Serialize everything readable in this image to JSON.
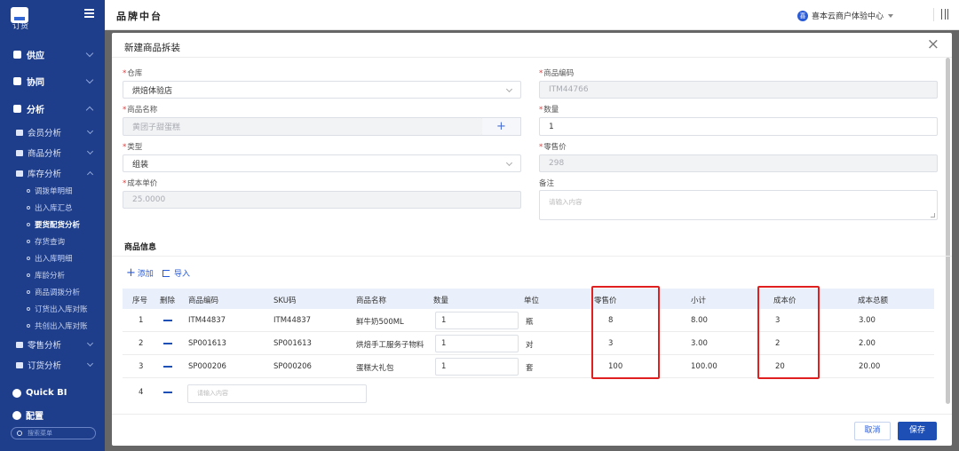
{
  "app": {
    "title": "品牌中台",
    "tenant": "喜本云商户体验中心",
    "tenant_badge": "喜"
  },
  "sidebar": {
    "top_partial": "订货",
    "menus": [
      {
        "label": "供应",
        "expanded": false
      },
      {
        "label": "协同",
        "expanded": false
      },
      {
        "label": "分析",
        "expanded": true
      }
    ],
    "groups": [
      {
        "label": "会员分析",
        "expanded": false
      },
      {
        "label": "商品分析",
        "expanded": false
      },
      {
        "label": "库存分析",
        "expanded": true
      }
    ],
    "leaves": [
      "调拨单明细",
      "出入库汇总",
      "要货配货分析",
      "存货查询",
      "出入库明细",
      "库龄分析",
      "商品调拨分析",
      "订货出入库对账",
      "共创出入库对账"
    ],
    "active_leaf": "要货配货分析",
    "more_groups": [
      {
        "label": "零售分析",
        "expanded": false
      },
      {
        "label": "订货分析",
        "expanded": false
      }
    ],
    "quick_bi": "Quick BI",
    "config": "配置",
    "search_placeholder": "搜索菜单"
  },
  "modal": {
    "title": "新建商品拆装",
    "fields": {
      "warehouse": {
        "label": "仓库",
        "value": "烘焙体验店",
        "required": true
      },
      "product_code": {
        "label": "商品编码",
        "value": "ITM44766",
        "required": true,
        "disabled": true
      },
      "product_name": {
        "label": "商品名称",
        "value": "黄团子甜蛋糕",
        "required": true,
        "disabled": true
      },
      "quantity": {
        "label": "数量",
        "value": "1",
        "required": true
      },
      "type": {
        "label": "类型",
        "value": "组装",
        "required": true
      },
      "retail_price": {
        "label": "零售价",
        "value": "298",
        "required": true,
        "disabled": true
      },
      "unit_cost": {
        "label": "成本单价",
        "value": "25.0000",
        "required": true,
        "disabled": true
      },
      "remark": {
        "label": "备注",
        "placeholder": "请输入内容"
      }
    },
    "plus_symbol": "+",
    "section_title": "商品信息",
    "actions": {
      "add": "添加",
      "import": "导入"
    },
    "table": {
      "columns": [
        "序号",
        "删除",
        "商品编码",
        "SKU码",
        "商品名称",
        "数量",
        "单位",
        "零售价",
        "小计",
        "成本价",
        "成本总额"
      ],
      "rows": [
        {
          "no": "1",
          "code": "ITM44837",
          "sku": "ITM44837",
          "name": "鲜牛奶500ML",
          "qty": "1",
          "unit": "瓶",
          "price": "8",
          "subtotal": "8.00",
          "cost": "3",
          "cost_total": "3.00"
        },
        {
          "no": "2",
          "code": "SP001613",
          "sku": "SP001613",
          "name": "烘焙手工服务子物料",
          "qty": "1",
          "unit": "对",
          "price": "3",
          "subtotal": "3.00",
          "cost": "2",
          "cost_total": "2.00"
        },
        {
          "no": "3",
          "code": "SP000206",
          "sku": "SP000206",
          "name": "蛋糕大礼包",
          "qty": "1",
          "unit": "套",
          "price": "100",
          "subtotal": "100.00",
          "cost": "20",
          "cost_total": "20.00"
        }
      ],
      "new_row": {
        "no": "4",
        "placeholder": "请输入内容"
      }
    },
    "buttons": {
      "cancel": "取消",
      "save": "保存"
    }
  },
  "colors": {
    "sidebar": "#1e3e8c",
    "primary": "#1e4fb5",
    "highlight": "#e02020"
  }
}
